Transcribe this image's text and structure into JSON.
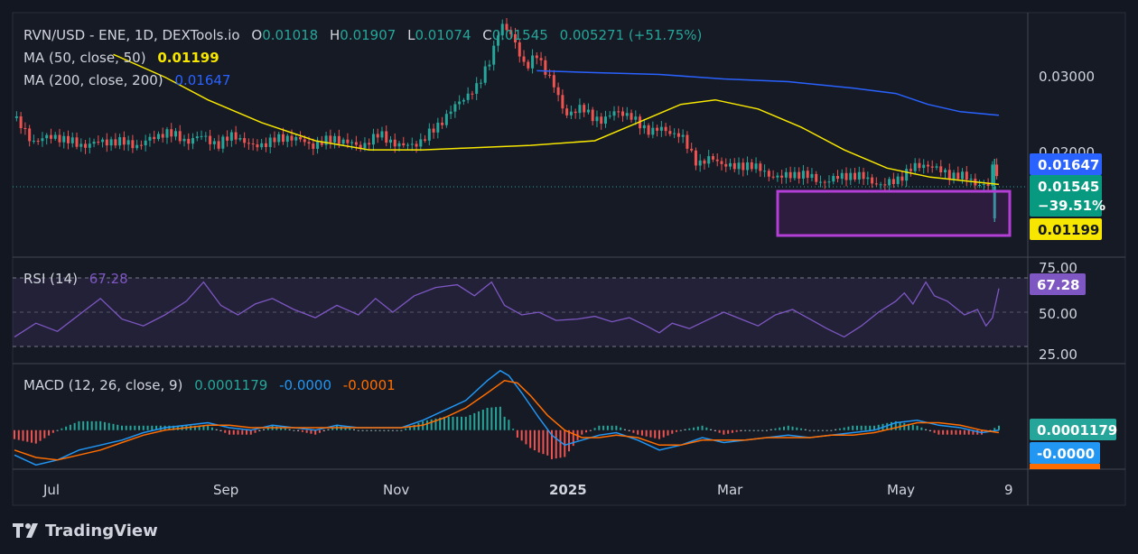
{
  "legend": {
    "symbol": "RVN/USD - ENE, 1D, DEXTools.io",
    "o_label": "O",
    "o": "0.01018",
    "h_label": "H",
    "h": "0.01907",
    "l_label": "L",
    "l": "0.01074",
    "c_label": "C",
    "c": "0.01545",
    "change": "0.005271 (+51.75%)",
    "ma50_label": "MA (50, close, 50)",
    "ma50_value": "0.01199",
    "ma200_label": "MA (200, close, 200)",
    "ma200_value": "0.01647",
    "rsi_label": "RSI (14)",
    "rsi_value": "67.28",
    "macd_label": "MACD (12, 26, close, 9)",
    "macd_hist": "0.0001179",
    "macd_line": "-0.0000",
    "macd_signal": "-0.0001"
  },
  "badges": {
    "ma200": "0.01647",
    "last_price": "0.01545",
    "change_pct": "−39.51%",
    "ma50": "0.01199",
    "rsi": "67.28",
    "macd_hist": "0.0001179",
    "macd_line": "-0.0000"
  },
  "price_scale": [
    "0.03000",
    "0.02000"
  ],
  "rsi_scale": [
    "75.00",
    "50.00",
    "25.00"
  ],
  "time_axis": [
    "Jul",
    "Sep",
    "Nov",
    "2025",
    "Mar",
    "May",
    "9"
  ],
  "brand": "TradingView",
  "colors": {
    "up": "#26a69a",
    "down": "#ef5350",
    "ma50": "#f7e600",
    "ma200": "#2962ff",
    "rsi": "#7e57c2",
    "macd": "#2196f3",
    "signal": "#ff6d00",
    "rect": "#b33fd6"
  },
  "chart_data": {
    "type": "line",
    "title": "RVN/USD - ENE, 1D, DEXTools.io",
    "ylim": [
      0.008,
      0.034
    ],
    "price_path": [
      [
        0,
        0.023
      ],
      [
        8,
        0.0205
      ],
      [
        20,
        0.021
      ],
      [
        30,
        0.02
      ],
      [
        45,
        0.0205
      ],
      [
        58,
        0.02
      ],
      [
        70,
        0.0215
      ],
      [
        80,
        0.0205
      ],
      [
        88,
        0.021
      ],
      [
        95,
        0.02
      ],
      [
        102,
        0.0213
      ],
      [
        110,
        0.0198
      ],
      [
        120,
        0.0205
      ],
      [
        128,
        0.021
      ],
      [
        138,
        0.02
      ],
      [
        150,
        0.0208
      ],
      [
        160,
        0.0198
      ],
      [
        170,
        0.0212
      ],
      [
        180,
        0.0198
      ],
      [
        190,
        0.0205
      ],
      [
        200,
        0.023
      ],
      [
        210,
        0.0255
      ],
      [
        216,
        0.0265
      ],
      [
        222,
        0.03
      ],
      [
        226,
        0.0332
      ],
      [
        232,
        0.032
      ],
      [
        238,
        0.0283
      ],
      [
        243,
        0.03
      ],
      [
        250,
        0.027
      ],
      [
        256,
        0.0235
      ],
      [
        264,
        0.024
      ],
      [
        274,
        0.0225
      ],
      [
        280,
        0.024
      ],
      [
        290,
        0.0225
      ],
      [
        296,
        0.0215
      ],
      [
        302,
        0.0218
      ],
      [
        310,
        0.021
      ],
      [
        318,
        0.018
      ],
      [
        325,
        0.0185
      ],
      [
        335,
        0.0175
      ],
      [
        342,
        0.018
      ],
      [
        350,
        0.0168
      ],
      [
        358,
        0.0165
      ],
      [
        366,
        0.017
      ],
      [
        374,
        0.016
      ],
      [
        380,
        0.0162
      ],
      [
        388,
        0.0168
      ],
      [
        394,
        0.0165
      ],
      [
        400,
        0.016
      ],
      [
        404,
        0.0155
      ],
      [
        410,
        0.0162
      ],
      [
        418,
        0.0175
      ],
      [
        424,
        0.018
      ],
      [
        430,
        0.0172
      ],
      [
        436,
        0.0168
      ],
      [
        442,
        0.0165
      ],
      [
        448,
        0.0158
      ],
      [
        453,
        0.0155
      ],
      [
        456,
        0.0185
      ],
      [
        458,
        0.0155
      ]
    ],
    "ma50_path": [
      [
        46,
        0.03
      ],
      [
        70,
        0.0275
      ],
      [
        90,
        0.025
      ],
      [
        115,
        0.0225
      ],
      [
        140,
        0.0205
      ],
      [
        165,
        0.0195
      ],
      [
        190,
        0.0195
      ],
      [
        210,
        0.0197
      ],
      [
        240,
        0.02
      ],
      [
        270,
        0.0205
      ],
      [
        290,
        0.0225
      ],
      [
        310,
        0.0245
      ],
      [
        326,
        0.025
      ],
      [
        346,
        0.024
      ],
      [
        366,
        0.022
      ],
      [
        386,
        0.0195
      ],
      [
        406,
        0.0175
      ],
      [
        426,
        0.0165
      ],
      [
        446,
        0.016
      ],
      [
        458,
        0.0157
      ]
    ],
    "ma200_path": [
      [
        243,
        0.0282
      ],
      [
        270,
        0.028
      ],
      [
        300,
        0.0278
      ],
      [
        330,
        0.0273
      ],
      [
        360,
        0.027
      ],
      [
        390,
        0.0263
      ],
      [
        410,
        0.0257
      ],
      [
        425,
        0.0245
      ],
      [
        440,
        0.0237
      ],
      [
        458,
        0.0233
      ]
    ],
    "rsi_ylim": [
      25,
      75
    ],
    "rsi_path": [
      [
        0,
        32
      ],
      [
        10,
        42
      ],
      [
        20,
        36
      ],
      [
        30,
        48
      ],
      [
        40,
        60
      ],
      [
        50,
        45
      ],
      [
        60,
        40
      ],
      [
        70,
        48
      ],
      [
        80,
        58
      ],
      [
        88,
        72
      ],
      [
        96,
        55
      ],
      [
        104,
        48
      ],
      [
        112,
        56
      ],
      [
        120,
        60
      ],
      [
        130,
        52
      ],
      [
        140,
        46
      ],
      [
        150,
        55
      ],
      [
        160,
        48
      ],
      [
        168,
        60
      ],
      [
        176,
        50
      ],
      [
        186,
        62
      ],
      [
        196,
        68
      ],
      [
        206,
        70
      ],
      [
        214,
        62
      ],
      [
        222,
        72
      ],
      [
        228,
        55
      ],
      [
        236,
        48
      ],
      [
        244,
        50
      ],
      [
        252,
        44
      ],
      [
        262,
        45
      ],
      [
        270,
        47
      ],
      [
        278,
        43
      ],
      [
        286,
        46
      ],
      [
        294,
        40
      ],
      [
        300,
        35
      ],
      [
        306,
        42
      ],
      [
        314,
        38
      ],
      [
        322,
        44
      ],
      [
        330,
        50
      ],
      [
        338,
        45
      ],
      [
        346,
        40
      ],
      [
        354,
        48
      ],
      [
        362,
        52
      ],
      [
        370,
        45
      ],
      [
        378,
        38
      ],
      [
        386,
        32
      ],
      [
        394,
        40
      ],
      [
        402,
        50
      ],
      [
        410,
        58
      ],
      [
        414,
        64
      ],
      [
        418,
        56
      ],
      [
        424,
        72
      ],
      [
        428,
        62
      ],
      [
        434,
        58
      ],
      [
        442,
        48
      ],
      [
        448,
        52
      ],
      [
        452,
        40
      ],
      [
        455,
        46
      ],
      [
        458,
        67.28
      ]
    ],
    "macd_ylim": [
      -0.0015,
      0.0025
    ],
    "macd_line_path": [
      [
        0,
        -0.001
      ],
      [
        10,
        -0.0014
      ],
      [
        20,
        -0.0012
      ],
      [
        30,
        -0.0008
      ],
      [
        40,
        -0.0006
      ],
      [
        50,
        -0.0004
      ],
      [
        60,
        -0.0001
      ],
      [
        70,
        0.0001
      ],
      [
        80,
        0.0002
      ],
      [
        90,
        0.0003
      ],
      [
        100,
        0.0001
      ],
      [
        110,
        0.0
      ],
      [
        120,
        0.0002
      ],
      [
        130,
        0.0001
      ],
      [
        140,
        0.0
      ],
      [
        150,
        0.0002
      ],
      [
        160,
        0.0001
      ],
      [
        170,
        0.0001
      ],
      [
        180,
        0.0001
      ],
      [
        190,
        0.0004
      ],
      [
        200,
        0.0008
      ],
      [
        210,
        0.0012
      ],
      [
        220,
        0.002
      ],
      [
        226,
        0.0024
      ],
      [
        230,
        0.0022
      ],
      [
        236,
        0.0015
      ],
      [
        244,
        0.0005
      ],
      [
        250,
        -0.0002
      ],
      [
        256,
        -0.0006
      ],
      [
        264,
        -0.0004
      ],
      [
        272,
        -0.0002
      ],
      [
        280,
        -0.0001
      ],
      [
        290,
        -0.0004
      ],
      [
        300,
        -0.0008
      ],
      [
        310,
        -0.0006
      ],
      [
        320,
        -0.0003
      ],
      [
        330,
        -0.0005
      ],
      [
        340,
        -0.0004
      ],
      [
        350,
        -0.0003
      ],
      [
        360,
        -0.0002
      ],
      [
        370,
        -0.0003
      ],
      [
        380,
        -0.0002
      ],
      [
        390,
        -0.0001
      ],
      [
        400,
        0.0
      ],
      [
        410,
        0.0003
      ],
      [
        420,
        0.0004
      ],
      [
        430,
        0.0002
      ],
      [
        440,
        0.0001
      ],
      [
        450,
        -0.0001
      ],
      [
        458,
        0.0
      ]
    ],
    "macd_signal_path": [
      [
        0,
        -0.0008
      ],
      [
        10,
        -0.0011
      ],
      [
        20,
        -0.0012
      ],
      [
        30,
        -0.001
      ],
      [
        40,
        -0.0008
      ],
      [
        50,
        -0.0005
      ],
      [
        60,
        -0.0002
      ],
      [
        70,
        0.0
      ],
      [
        80,
        0.0001
      ],
      [
        90,
        0.0002
      ],
      [
        100,
        0.0002
      ],
      [
        110,
        0.0001
      ],
      [
        120,
        0.0001
      ],
      [
        130,
        0.0001
      ],
      [
        140,
        0.0001
      ],
      [
        150,
        0.0001
      ],
      [
        160,
        0.0001
      ],
      [
        170,
        0.0001
      ],
      [
        180,
        0.0001
      ],
      [
        190,
        0.0002
      ],
      [
        200,
        0.0005
      ],
      [
        210,
        0.0009
      ],
      [
        220,
        0.0015
      ],
      [
        228,
        0.002
      ],
      [
        234,
        0.0019
      ],
      [
        240,
        0.0014
      ],
      [
        248,
        0.0006
      ],
      [
        256,
        0.0
      ],
      [
        264,
        -0.0003
      ],
      [
        272,
        -0.0003
      ],
      [
        280,
        -0.0002
      ],
      [
        290,
        -0.0003
      ],
      [
        300,
        -0.0006
      ],
      [
        310,
        -0.0006
      ],
      [
        320,
        -0.0004
      ],
      [
        330,
        -0.0004
      ],
      [
        340,
        -0.0004
      ],
      [
        350,
        -0.0003
      ],
      [
        360,
        -0.0003
      ],
      [
        370,
        -0.0003
      ],
      [
        380,
        -0.0002
      ],
      [
        390,
        -0.0002
      ],
      [
        400,
        -0.0001
      ],
      [
        410,
        0.0001
      ],
      [
        420,
        0.0003
      ],
      [
        430,
        0.0003
      ],
      [
        440,
        0.0002
      ],
      [
        450,
        0.0
      ],
      [
        458,
        -0.0001
      ]
    ]
  }
}
